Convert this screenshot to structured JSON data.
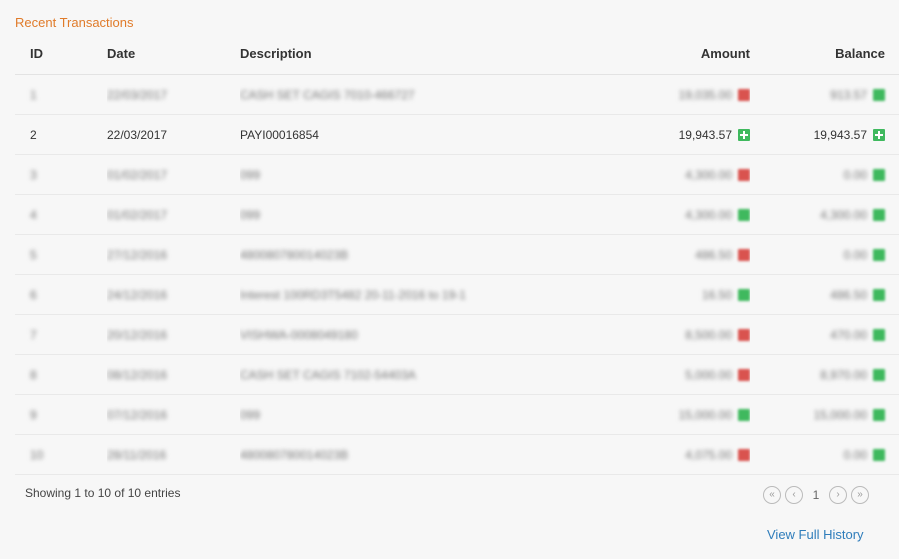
{
  "title": "Recent Transactions",
  "columns": {
    "id": "ID",
    "date": "Date",
    "description": "Description",
    "amount": "Amount",
    "balance": "Balance"
  },
  "rows": [
    {
      "id": "1",
      "date": "22/03/2017",
      "description": "CASH SET CAGIS 7010-466727",
      "amount": "19,035.00",
      "amount_status": "red",
      "balance": "913.57",
      "balance_status": "green",
      "blurred": true
    },
    {
      "id": "2",
      "date": "22/03/2017",
      "description": "PAYI00016854",
      "amount": "19,943.57",
      "amount_status": "green",
      "balance": "19,943.57",
      "balance_status": "green",
      "blurred": false
    },
    {
      "id": "3",
      "date": "01/02/2017",
      "description": "099",
      "amount": "4,300.00",
      "amount_status": "red",
      "balance": "0.00",
      "balance_status": "green",
      "blurred": true
    },
    {
      "id": "4",
      "date": "01/02/2017",
      "description": "099",
      "amount": "4,300.00",
      "amount_status": "green",
      "balance": "4,300.00",
      "balance_status": "green",
      "blurred": true
    },
    {
      "id": "5",
      "date": "27/12/2016",
      "description": "480080780014023B",
      "amount": "486.50",
      "amount_status": "red",
      "balance": "0.00",
      "balance_status": "green",
      "blurred": true
    },
    {
      "id": "6",
      "date": "24/12/2016",
      "description": "Interest 100RD3T5482 20-11-2016 to 19-1",
      "amount": "16.50",
      "amount_status": "green",
      "balance": "486.50",
      "balance_status": "green",
      "blurred": true
    },
    {
      "id": "7",
      "date": "20/12/2016",
      "description": "VISHWA-0008049180",
      "amount": "8,500.00",
      "amount_status": "red",
      "balance": "470.00",
      "balance_status": "green",
      "blurred": true
    },
    {
      "id": "8",
      "date": "08/12/2016",
      "description": "CASH SET CAGIS 7102-54403A",
      "amount": "5,000.00",
      "amount_status": "red",
      "balance": "8,970.00",
      "balance_status": "green",
      "blurred": true
    },
    {
      "id": "9",
      "date": "07/12/2016",
      "description": "099",
      "amount": "15,000.00",
      "amount_status": "green",
      "balance": "15,000.00",
      "balance_status": "green",
      "blurred": true
    },
    {
      "id": "10",
      "date": "28/11/2016",
      "description": "480080780014023B",
      "amount": "4,075.00",
      "amount_status": "red",
      "balance": "0.00",
      "balance_status": "green",
      "blurred": true
    }
  ],
  "footer": {
    "showing": "Showing 1 to 10 of 10 entries",
    "current_page": "1",
    "view_history": "View Full History"
  },
  "icons": {
    "first": "double-chevron-left-icon",
    "prev": "chevron-left-icon",
    "next": "chevron-right-icon",
    "last": "double-chevron-right-icon",
    "status_green": "plus-square-icon",
    "status_red": "minus-square-icon"
  },
  "colors": {
    "title": "#e07b2a",
    "link": "#2f7dbb",
    "green": "#3fb95e",
    "red": "#d9534f"
  }
}
